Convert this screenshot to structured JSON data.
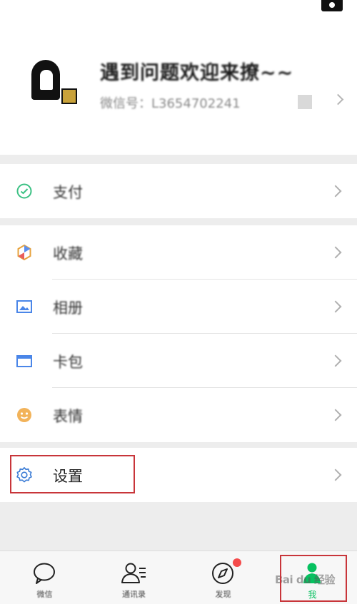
{
  "profile": {
    "nickname": "遇到问题欢迎来撩~~",
    "wechat_id_label": "微信号：",
    "wechat_id": "L3654702241"
  },
  "menu": {
    "pay": {
      "label": "支付",
      "icon": "pay-icon"
    },
    "favorites": {
      "label": "收藏",
      "icon": "favorites-icon"
    },
    "album": {
      "label": "相册",
      "icon": "album-icon"
    },
    "cards": {
      "label": "卡包",
      "icon": "card-wallet-icon"
    },
    "stickers": {
      "label": "表情",
      "icon": "sticker-icon"
    },
    "settings": {
      "label": "设置",
      "icon": "gear-icon"
    }
  },
  "tabs": [
    {
      "label": "微信",
      "icon": "chat-bubble-icon"
    },
    {
      "label": "通讯录",
      "icon": "contacts-icon"
    },
    {
      "label": "发现",
      "icon": "compass-icon"
    },
    {
      "label": "我",
      "icon": "me-icon"
    }
  ],
  "watermark": "Bai du 经验",
  "colors": {
    "accent": "#07c160",
    "highlight": "#c8353a",
    "badge": "#f44b4b"
  }
}
